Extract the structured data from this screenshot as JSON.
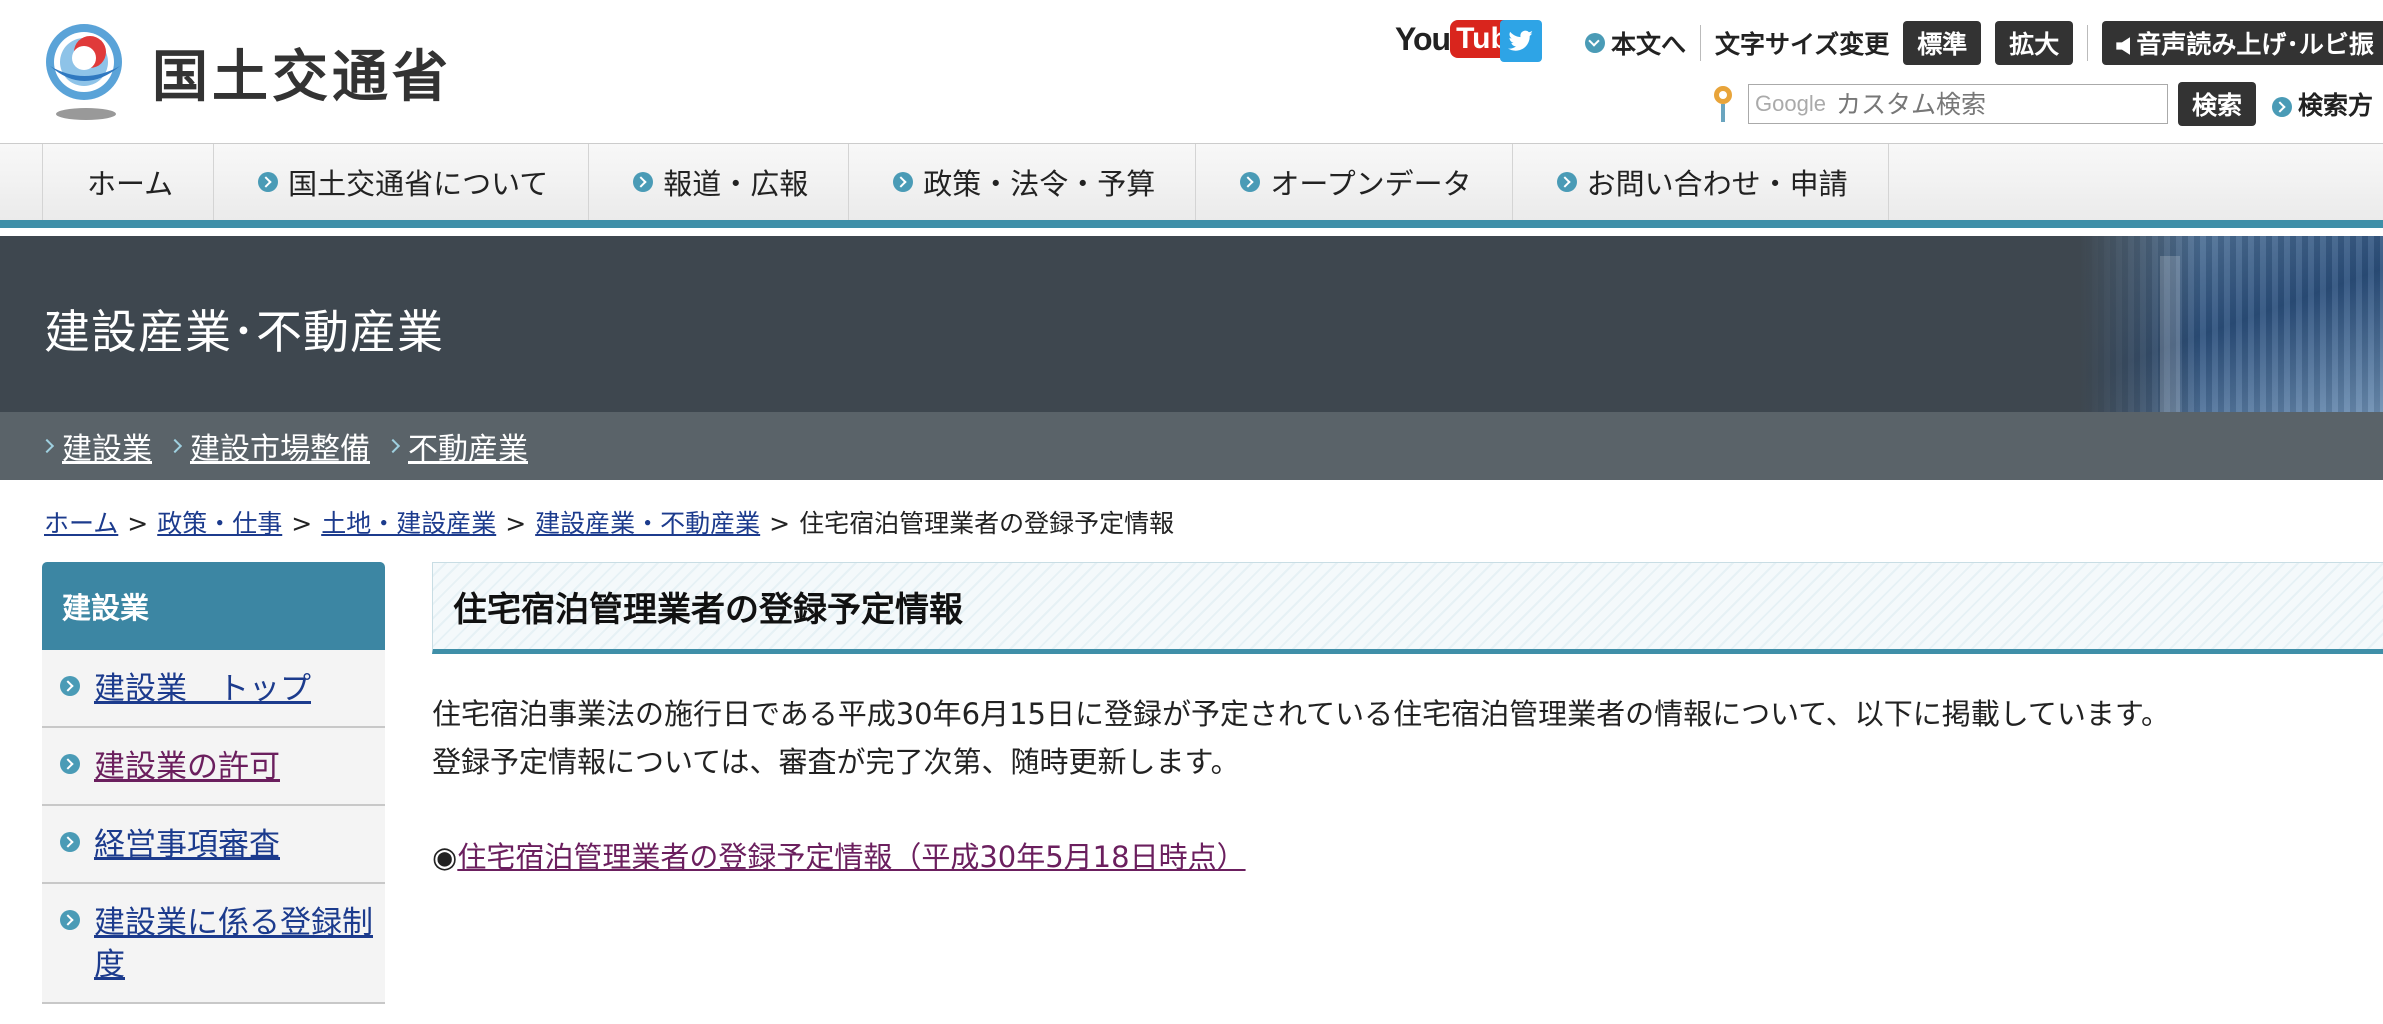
{
  "header": {
    "logo_text": "国土交通省",
    "youtube_you": "You",
    "youtube_tube": "Tube",
    "skip_to_content": "本文へ",
    "font_size_label": "文字サイズ変更",
    "font_standard": "標準",
    "font_large": "拡大",
    "voice_label": "音声読み上げ･ルビ振",
    "search_brand": "Google",
    "search_placeholder": "カスタム検索",
    "search_button": "検索",
    "search_how": "検索方"
  },
  "global_nav": [
    "ホーム",
    "国土交通省について",
    "報道・広報",
    "政策・法令・予算",
    "オープンデータ",
    "お問い合わせ・申請"
  ],
  "section": {
    "title": "建設産業･不動産業",
    "subnav": [
      "建設業",
      "建設市場整備",
      "不動産業"
    ]
  },
  "breadcrumb": {
    "items": [
      "ホーム",
      "政策・仕事",
      "土地・建設産業",
      "建設産業・不動産業"
    ],
    "separator": ">",
    "current": "住宅宿泊管理業者の登録予定情報"
  },
  "sidebar": {
    "heading": "建設業",
    "items": [
      "建設業　トップ",
      "建設業の許可",
      "経営事項審査",
      "建設業に係る登録制度"
    ]
  },
  "main": {
    "title": "住宅宿泊管理業者の登録予定情報",
    "para1": "住宅宿泊事業法の施行日である平成30年6月15日に登録が予定されている住宅宿泊管理業者の情報について、以下に掲載しています。",
    "para2": "登録予定情報については、審査が完了次第、随時更新します。",
    "link_bullet": "◉",
    "link_text": "住宅宿泊管理業者の登録予定情報（平成30年5月18日時点）"
  },
  "colors": {
    "accent": "#3f8fa8",
    "banner_bg": "#3e474f",
    "subnav_bg": "#5a6369",
    "link": "#1c3b8d",
    "visited_link": "#6b1f5e"
  }
}
